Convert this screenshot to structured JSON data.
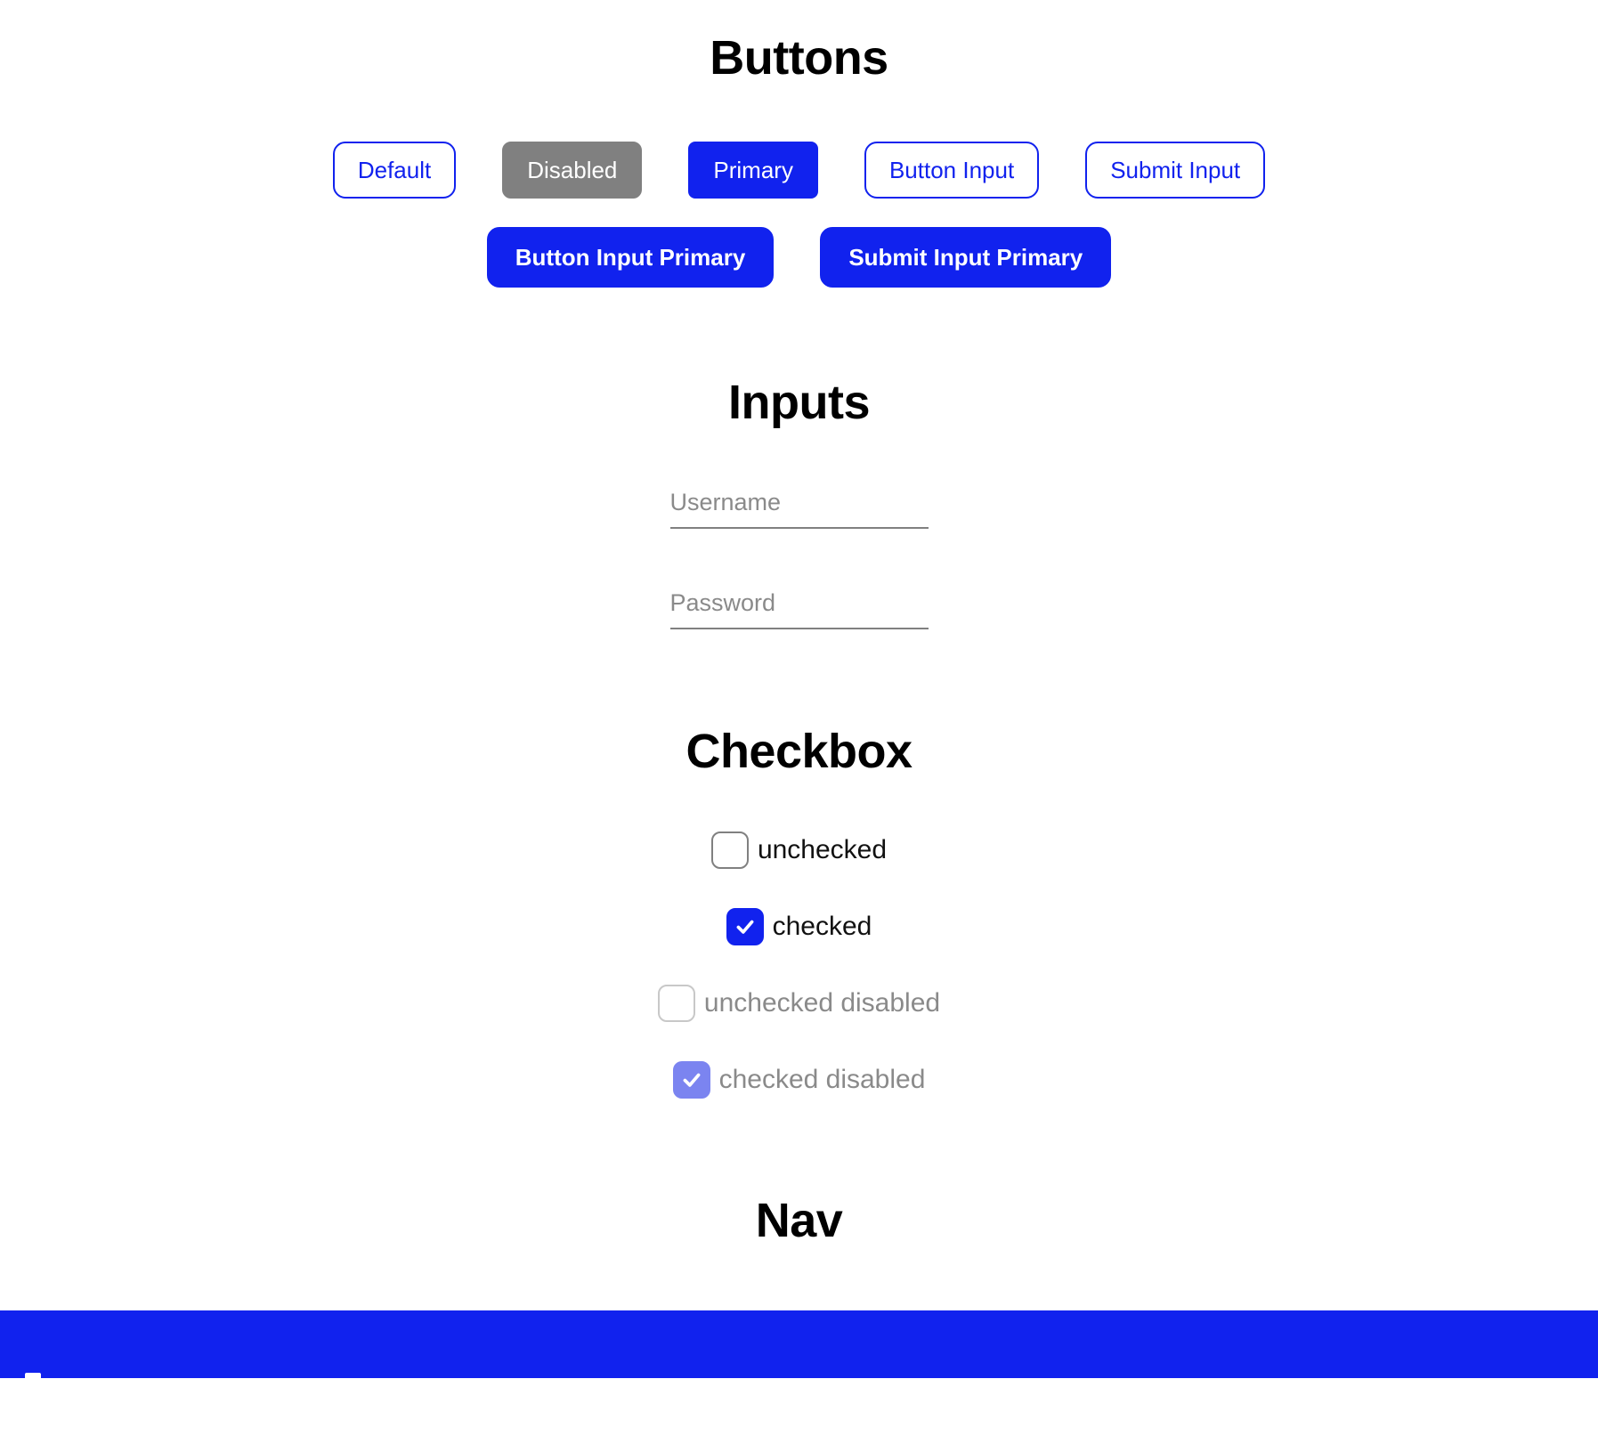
{
  "theme": {
    "accent": "#1122ee",
    "accent_faded": "#7b84f0",
    "disabled_gray": "#808080",
    "placeholder_gray": "#8a8a8a",
    "background": "#ffffff"
  },
  "buttons": {
    "heading": "Buttons",
    "row1": [
      {
        "label": "Default",
        "style": "outline",
        "disabled": false
      },
      {
        "label": "Disabled",
        "style": "disabled",
        "disabled": true
      },
      {
        "label": "Primary",
        "style": "primary",
        "disabled": false
      },
      {
        "label": "Button Input",
        "style": "outline",
        "disabled": false
      },
      {
        "label": "Submit Input",
        "style": "outline",
        "disabled": false
      }
    ],
    "row2": [
      {
        "label": "Button Input Primary",
        "style": "primary-round",
        "disabled": false
      },
      {
        "label": "Submit Input Primary",
        "style": "primary-round",
        "disabled": false
      }
    ]
  },
  "inputs": {
    "heading": "Inputs",
    "fields": [
      {
        "name": "username",
        "placeholder": "Username",
        "value": "",
        "type": "text"
      },
      {
        "name": "password",
        "placeholder": "Password",
        "value": "",
        "type": "password"
      }
    ]
  },
  "checkbox": {
    "heading": "Checkbox",
    "items": [
      {
        "label": "unchecked",
        "checked": false,
        "disabled": false
      },
      {
        "label": "checked",
        "checked": true,
        "disabled": false
      },
      {
        "label": "unchecked disabled",
        "checked": false,
        "disabled": true
      },
      {
        "label": "checked disabled",
        "checked": true,
        "disabled": true
      }
    ]
  },
  "nav": {
    "heading": "Nav",
    "bar_color": "#1122ee"
  }
}
